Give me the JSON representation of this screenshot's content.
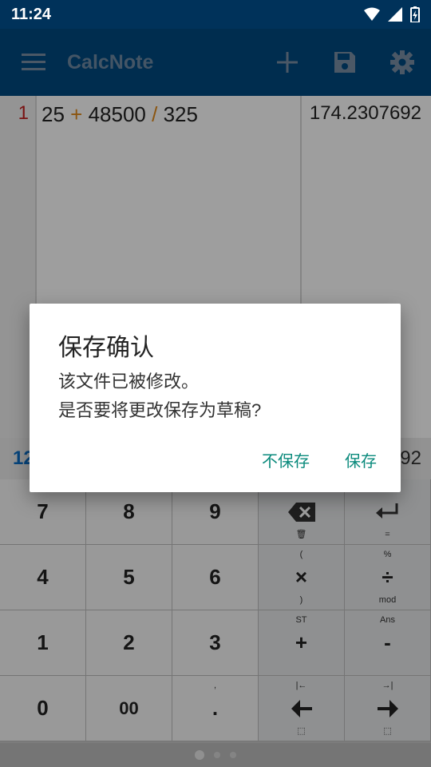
{
  "status_bar": {
    "time": "11:24"
  },
  "app_bar": {
    "title": "CalcNote"
  },
  "editor": {
    "line_number": "1",
    "expression": {
      "a": "25",
      "op1": "+",
      "b": "48500",
      "op2": "/",
      "c": "325"
    },
    "result": "174.2307692"
  },
  "result_strip": {
    "left": "12",
    "right": "92"
  },
  "keypad": {
    "k7": "7",
    "k8": "8",
    "k9": "9",
    "k4": "4",
    "k5": "5",
    "k6": "6",
    "k1": "1",
    "k2": "2",
    "k3": "3",
    "k0": "0",
    "k00": "00",
    "kdot": ".",
    "kdot_top": ",",
    "backspace_bottom": "🗑",
    "enter_bottom": "=",
    "mul": "×",
    "mul_top": "(",
    "mul_bottom": ")",
    "div": "÷",
    "div_top": "%",
    "div_bottom": "mod",
    "plus": "+",
    "plus_top": "ST",
    "minus": "-",
    "minus_top": "Ans",
    "left_top": "|←",
    "right_top": "→|"
  },
  "dialog": {
    "title": "保存确认",
    "message_line1": "该文件已被修改。",
    "message_line2": "是否要将更改保存为草稿?",
    "dont_save": "不保存",
    "save": "保存"
  },
  "colors": {
    "app_bar": "#004a80",
    "status_bar": "#00325a",
    "accent_button": "#0a8a7c",
    "operator": "#e08a1a",
    "line_number": "#c41e1e"
  }
}
